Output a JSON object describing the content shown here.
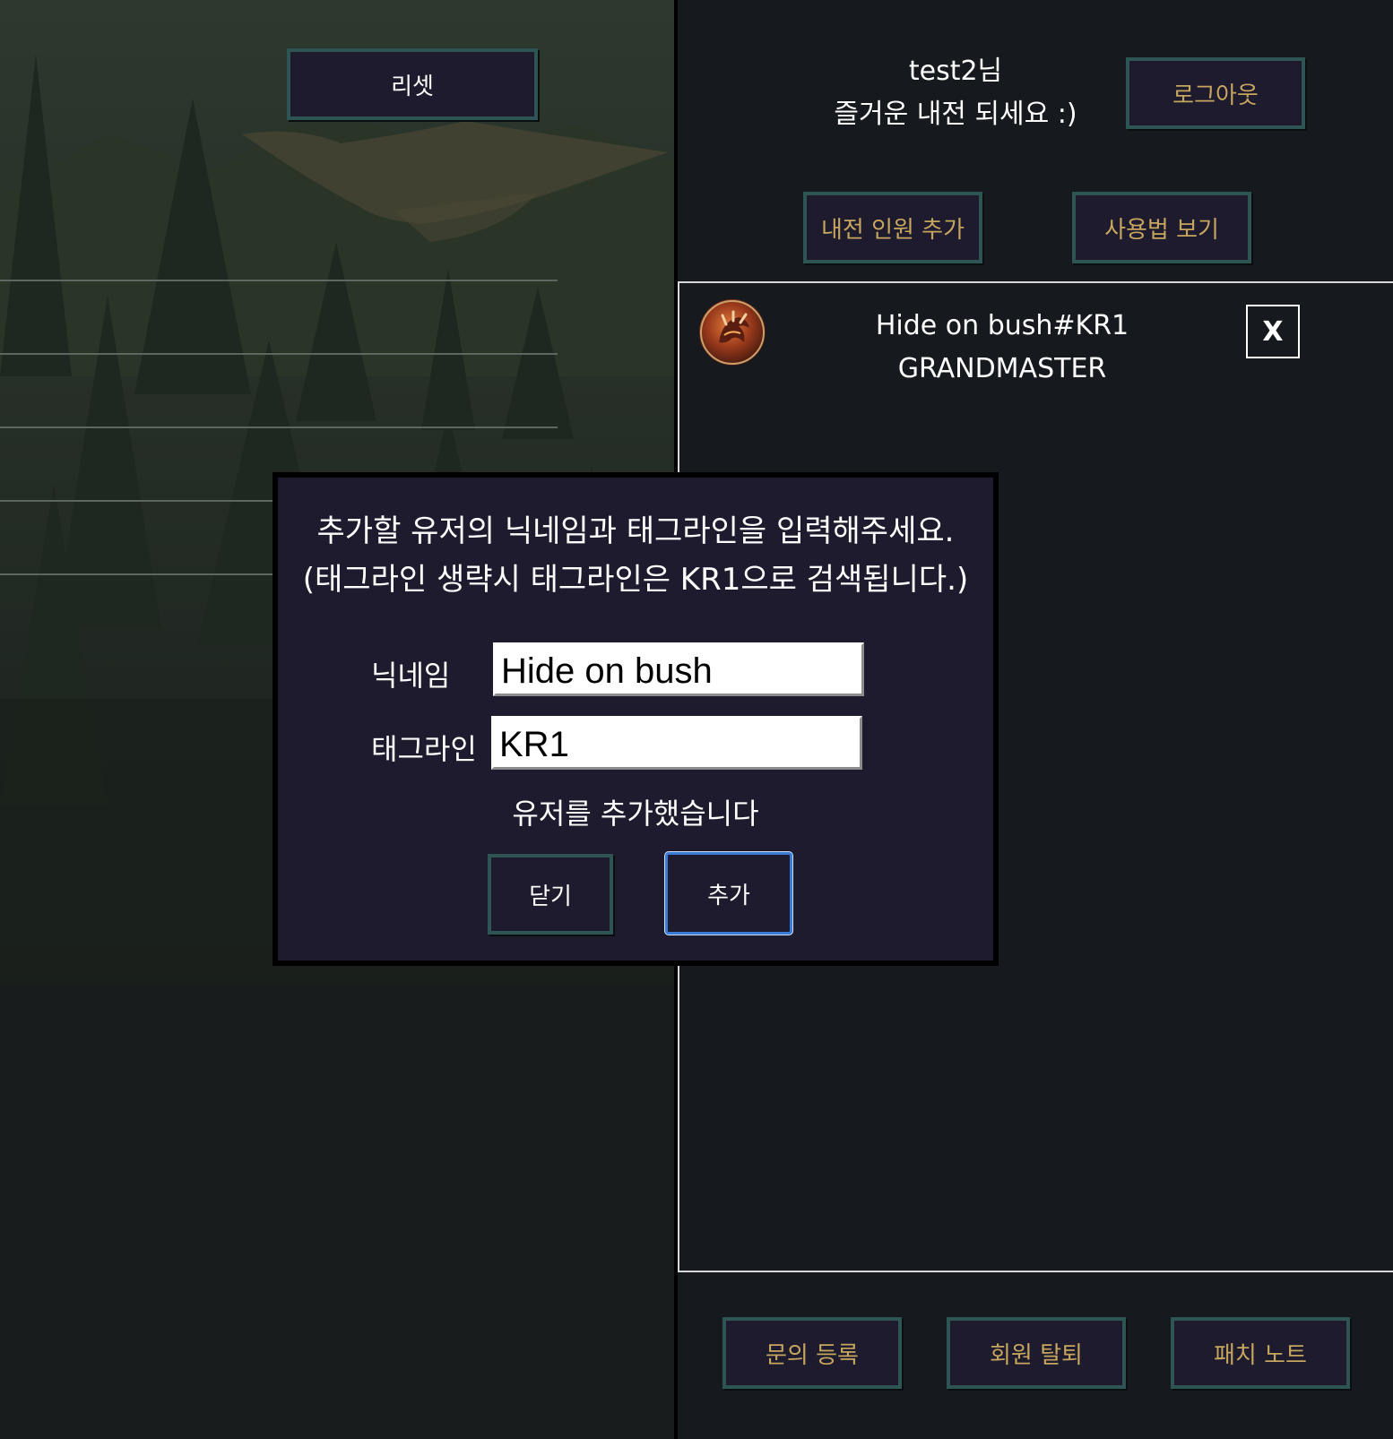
{
  "left_panel": {
    "reset_label": "리셋"
  },
  "header": {
    "welcome_line1": "test2님",
    "welcome_line2": "즐거운 내전 되세요 :)",
    "logout_label": "로그아웃",
    "add_members_label": "내전 인원 추가",
    "help_label": "사용법 보기"
  },
  "players": [
    {
      "name": "Hide on bush#KR1",
      "tier": "GRANDMASTER",
      "remove_label": "X",
      "avatar_icon": "dragon-claw-profile-icon"
    }
  ],
  "dialog": {
    "instruction_line1": "추가할 유저의 닉네임과 태그라인을 입력해주세요.",
    "instruction_line2": "(태그라인 생략시 태그라인은 KR1으로 검색됩니다.)",
    "nickname_label": "닉네임",
    "nickname_value": "Hide on bush",
    "tagline_label": "태그라인",
    "tagline_value": "KR1",
    "status_message": "유저를 추가했습니다",
    "close_label": "닫기",
    "add_label": "추가"
  },
  "footer": {
    "inquiry_label": "문의 등록",
    "withdraw_label": "회원 탈퇴",
    "patch_notes_label": "패치 노트"
  },
  "colors": {
    "button_bg": "#1e1b2e",
    "button_border": "#2f5454",
    "gold_text": "#c6a65e",
    "focus_blue": "#3a7bd5"
  }
}
